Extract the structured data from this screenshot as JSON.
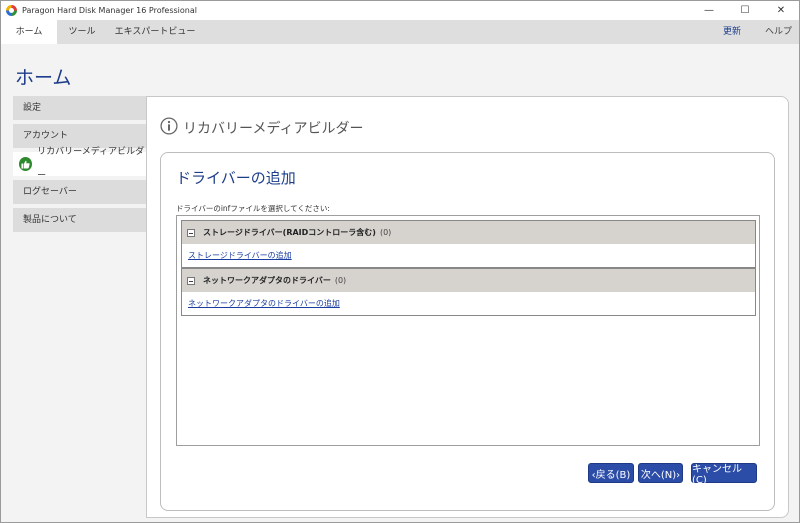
{
  "window": {
    "title": "Paragon Hard Disk Manager 16 Professional",
    "controls": {
      "minimize": "—",
      "maximize": "☐",
      "close": "✕"
    }
  },
  "menubar": {
    "tabs": [
      "ホーム",
      "ツール",
      "エキスパートビュー"
    ],
    "active_tab": 0,
    "update_label": "更新",
    "help_label": "ヘルプ",
    "update_color": "#1d3d8a"
  },
  "page": {
    "title": "ホーム"
  },
  "sidebar": {
    "items": [
      {
        "label": "設定"
      },
      {
        "label": "アカウント"
      },
      {
        "label": "リカバリーメディアビルダー"
      },
      {
        "label": "ログセーバー"
      },
      {
        "label": "製品について"
      }
    ],
    "active_index": 2,
    "active_icon": "thumbs-up-icon"
  },
  "section": {
    "icon": "info-icon",
    "title": "リカバリーメディアビルダー"
  },
  "card": {
    "title": "ドライバーの追加",
    "instruction": "ドライバーのinfファイルを選択してください:",
    "groups": [
      {
        "name": "ストレージドライバー(RAIDコントローラ含む)",
        "count": "(0)",
        "link": "ストレージドライバーの追加"
      },
      {
        "name": "ネットワークアダプタのドライバー",
        "count": "(0)",
        "link": "ネットワークアダプタのドライバーの追加"
      }
    ]
  },
  "buttons": {
    "back": "‹戻る(B)",
    "next": "次へ(N)›",
    "cancel": "キャンセル(C)"
  },
  "colors": {
    "accent": "#1d3d8a",
    "button": "#2b4da8",
    "active_badge": "#2f8a2f"
  }
}
